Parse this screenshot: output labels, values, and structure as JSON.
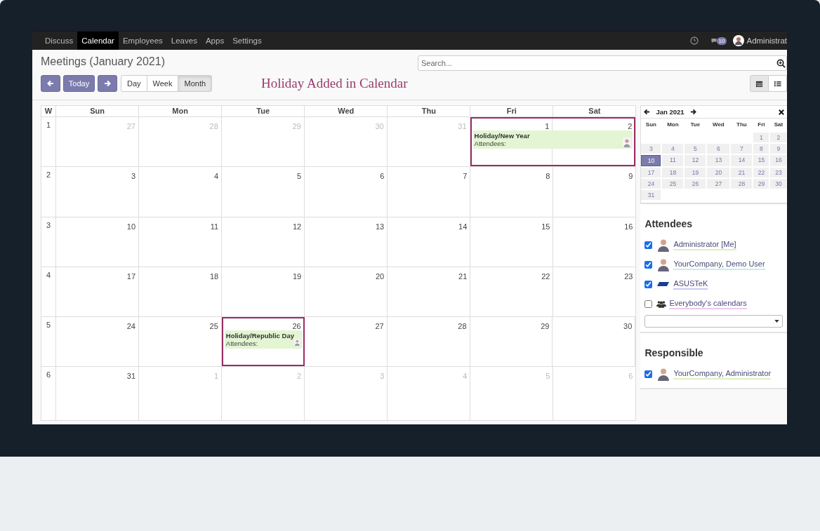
{
  "menu": [
    {
      "label": "Discuss",
      "selected": false
    },
    {
      "label": "Calendar",
      "selected": true
    },
    {
      "label": "Employees",
      "selected": false
    },
    {
      "label": "Leaves",
      "selected": false
    },
    {
      "label": "Apps",
      "selected": false
    },
    {
      "label": "Settings",
      "selected": false
    }
  ],
  "topbar": {
    "messages_badge": "10",
    "user": "Administrat"
  },
  "title": "Meetings (January 2021)",
  "buttons": {
    "today": "Today",
    "views": [
      {
        "label": "Day",
        "selected": false
      },
      {
        "label": "Week",
        "selected": false
      },
      {
        "label": "Month",
        "selected": true
      }
    ]
  },
  "caption": "Holiday Added in Calendar",
  "search": {
    "placeholder": "Search..."
  },
  "view_switch": [
    {
      "kind": "calendar",
      "selected": true
    },
    {
      "kind": "list",
      "selected": false
    }
  ],
  "calendar": {
    "week_header": "W",
    "weekdays": [
      "Sun",
      "Mon",
      "Tue",
      "Wed",
      "Thu",
      "Fri",
      "Sat"
    ],
    "weeks": [
      {
        "number": "1",
        "days": [
          {
            "day": "27",
            "other_month": true
          },
          {
            "day": "28",
            "other_month": true
          },
          {
            "day": "29",
            "other_month": true
          },
          {
            "day": "30",
            "other_month": true
          },
          {
            "day": "31",
            "other_month": true
          },
          {
            "day": "1",
            "other_month": false,
            "event": {
              "title": "Holiday/New Year",
              "label": "Attendees:",
              "selected": true
            }
          },
          {
            "day": "2",
            "other_month": false,
            "continued": true
          }
        ]
      },
      {
        "number": "2",
        "days": [
          {
            "day": "3",
            "other_month": false
          },
          {
            "day": "4",
            "other_month": false
          },
          {
            "day": "5",
            "other_month": false
          },
          {
            "day": "6",
            "other_month": false
          },
          {
            "day": "7",
            "other_month": false
          },
          {
            "day": "8",
            "other_month": false
          },
          {
            "day": "9",
            "other_month": false
          }
        ]
      },
      {
        "number": "3",
        "days": [
          {
            "day": "10",
            "other_month": false
          },
          {
            "day": "11",
            "other_month": false
          },
          {
            "day": "12",
            "other_month": false
          },
          {
            "day": "13",
            "other_month": false
          },
          {
            "day": "14",
            "other_month": false
          },
          {
            "day": "15",
            "other_month": false
          },
          {
            "day": "16",
            "other_month": false
          }
        ]
      },
      {
        "number": "4",
        "days": [
          {
            "day": "17",
            "other_month": false
          },
          {
            "day": "18",
            "other_month": false
          },
          {
            "day": "19",
            "other_month": false
          },
          {
            "day": "20",
            "other_month": false
          },
          {
            "day": "21",
            "other_month": false
          },
          {
            "day": "22",
            "other_month": false
          },
          {
            "day": "23",
            "other_month": false
          }
        ]
      },
      {
        "number": "5",
        "days": [
          {
            "day": "24",
            "other_month": false
          },
          {
            "day": "25",
            "other_month": false
          },
          {
            "day": "26",
            "other_month": false,
            "event": {
              "title": "Holiday/Republic Day",
              "label": "Attendees:",
              "selected": true
            }
          },
          {
            "day": "27",
            "other_month": false
          },
          {
            "day": "28",
            "other_month": false
          },
          {
            "day": "29",
            "other_month": false
          },
          {
            "day": "30",
            "other_month": false
          }
        ]
      },
      {
        "number": "6",
        "days": [
          {
            "day": "31",
            "other_month": false
          },
          {
            "day": "1",
            "other_month": true
          },
          {
            "day": "2",
            "other_month": true
          },
          {
            "day": "3",
            "other_month": true
          },
          {
            "day": "4",
            "other_month": true
          },
          {
            "day": "5",
            "other_month": true
          },
          {
            "day": "6",
            "other_month": true
          }
        ]
      }
    ]
  },
  "mini_calendar": {
    "title": "Jan 2021",
    "weekdays": [
      "Sun",
      "Mon",
      "Tue",
      "Wed",
      "Thu",
      "Fri",
      "Sat"
    ],
    "weeks": [
      [
        {
          "day": "1",
          "selected": false
        },
        {
          "day": "2",
          "selected": false
        }
      ],
      [
        {
          "day": "3",
          "selected": false
        },
        {
          "day": "4",
          "selected": false
        },
        {
          "day": "5",
          "selected": false
        },
        {
          "day": "6",
          "selected": false
        },
        {
          "day": "7",
          "selected": false
        },
        {
          "day": "8",
          "selected": false
        },
        {
          "day": "9",
          "selected": false
        }
      ],
      [
        {
          "day": "10",
          "selected": true
        },
        {
          "day": "11",
          "selected": false
        },
        {
          "day": "12",
          "selected": false
        },
        {
          "day": "13",
          "selected": false
        },
        {
          "day": "14",
          "selected": false
        },
        {
          "day": "15",
          "selected": false
        },
        {
          "day": "16",
          "selected": false
        }
      ],
      [
        {
          "day": "17",
          "selected": false
        },
        {
          "day": "18",
          "selected": false
        },
        {
          "day": "19",
          "selected": false
        },
        {
          "day": "20",
          "selected": false
        },
        {
          "day": "21",
          "selected": false
        },
        {
          "day": "22",
          "selected": false
        },
        {
          "day": "23",
          "selected": false
        }
      ],
      [
        {
          "day": "24",
          "selected": false
        },
        {
          "day": "25",
          "selected": false
        },
        {
          "day": "26",
          "selected": false
        },
        {
          "day": "27",
          "selected": false
        },
        {
          "day": "28",
          "selected": false
        },
        {
          "day": "29",
          "selected": false
        },
        {
          "day": "30",
          "selected": false
        }
      ],
      [
        {
          "day": "31",
          "selected": false
        }
      ]
    ]
  },
  "attendees": {
    "title": "Attendees",
    "items": [
      {
        "kind": "avatar",
        "name": "Administrator [Me]",
        "checked": true,
        "color": "#d9f0c0"
      },
      {
        "kind": "avatar",
        "name": "YourCompany, Demo User",
        "checked": true,
        "color": "#c4f0e8"
      },
      {
        "kind": "logo",
        "name": "ASUSTeK",
        "checked": true,
        "color": "#c8c8f4"
      },
      {
        "kind": "group",
        "name": "Everybody's calendars",
        "checked": false,
        "color": "#f0c8f0"
      }
    ]
  },
  "responsible": {
    "title": "Responsible",
    "items": [
      {
        "kind": "avatar",
        "name": "YourCompany, Administrator",
        "checked": true,
        "color": "#d9f0c0"
      }
    ]
  }
}
